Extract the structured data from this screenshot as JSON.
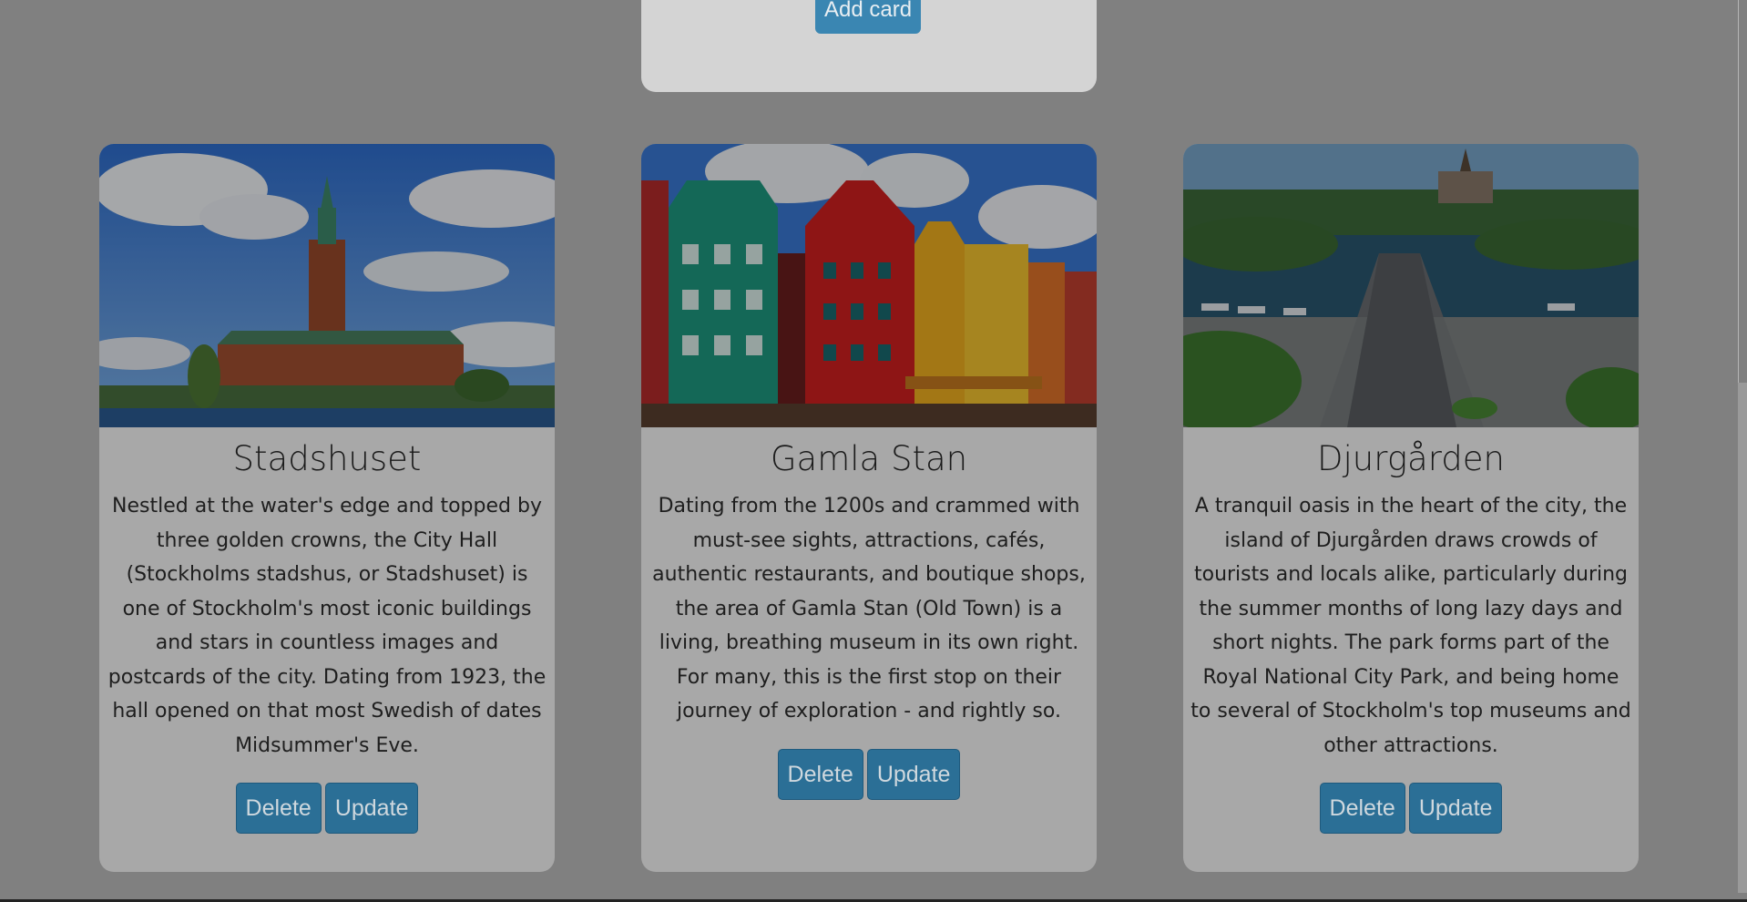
{
  "add_panel": {
    "button_label": "Add card"
  },
  "cards": [
    {
      "title": "Stadshuset",
      "image": "stockholm-city-hall-photo",
      "description": "Nestled at the water's edge and topped by three golden crowns, the City Hall (Stockholms stadshus, or Stadshuset) is one of Stockholm's most iconic buildings and stars in countless images and postcards of the city. Dating from 1923, the hall opened on that most Swedish of dates Midsummer's Eve.",
      "delete_label": "Delete",
      "update_label": "Update"
    },
    {
      "title": "Gamla Stan",
      "image": "gamla-stan-colorful-houses-photo",
      "description": "Dating from the 1200s and crammed with must-see sights, attractions, cafés, authentic restaurants, and boutique shops, the area of Gamla Stan (Old Town) is a living, breathing museum in its own right. For many, this is the first stop on their journey of exploration - and rightly so.",
      "delete_label": "Delete",
      "update_label": "Update"
    },
    {
      "title": "Djurgården",
      "image": "djurgarden-aerial-photo",
      "description": "A tranquil oasis in the heart of the city, the island of Djurgården draws crowds of tourists and locals alike, particularly during the summer months of long lazy days and short nights. The park forms part of the Royal National City Park, and being home to several of Stockholm's top museums and other attractions.",
      "delete_label": "Delete",
      "update_label": "Update"
    }
  ],
  "colors": {
    "backdrop": "#808080",
    "card": "#a8a8a8",
    "button": "#2b6f96",
    "add_button": "#3a86b2"
  }
}
